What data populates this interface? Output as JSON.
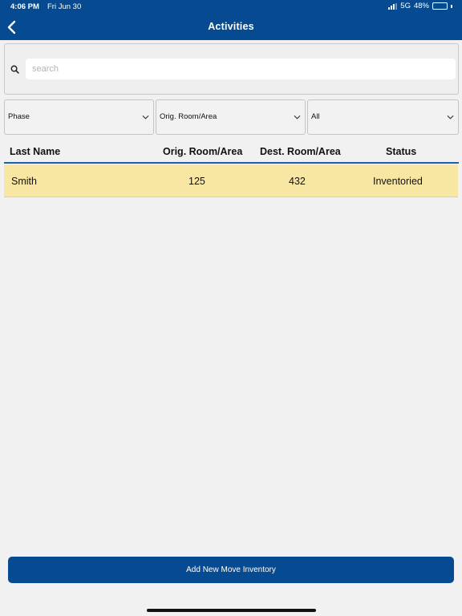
{
  "status_bar": {
    "time": "4:06 PM",
    "date": "Fri Jun 30",
    "network": "5G",
    "battery": "48%",
    "battery_level": 0.48
  },
  "header": {
    "title": "Activities",
    "back_icon": "chevron-left-icon"
  },
  "search": {
    "placeholder": "search",
    "value": "",
    "icon": "search-icon"
  },
  "filters": [
    {
      "label": "Phase"
    },
    {
      "label": "Orig. Room/Area"
    },
    {
      "label": "All"
    }
  ],
  "table": {
    "columns": [
      "Last Name",
      "Orig. Room/Area",
      "Dest. Room/Area",
      "Status"
    ],
    "rows": [
      {
        "last_name": "Smith",
        "orig": "125",
        "dest": "432",
        "status": "Inventoried"
      }
    ]
  },
  "footer": {
    "add_button_label": "Add New Move Inventory"
  },
  "colors": {
    "primary": "#064b92",
    "row_highlight": "#f8e6a3",
    "background": "#f1f1f1"
  }
}
